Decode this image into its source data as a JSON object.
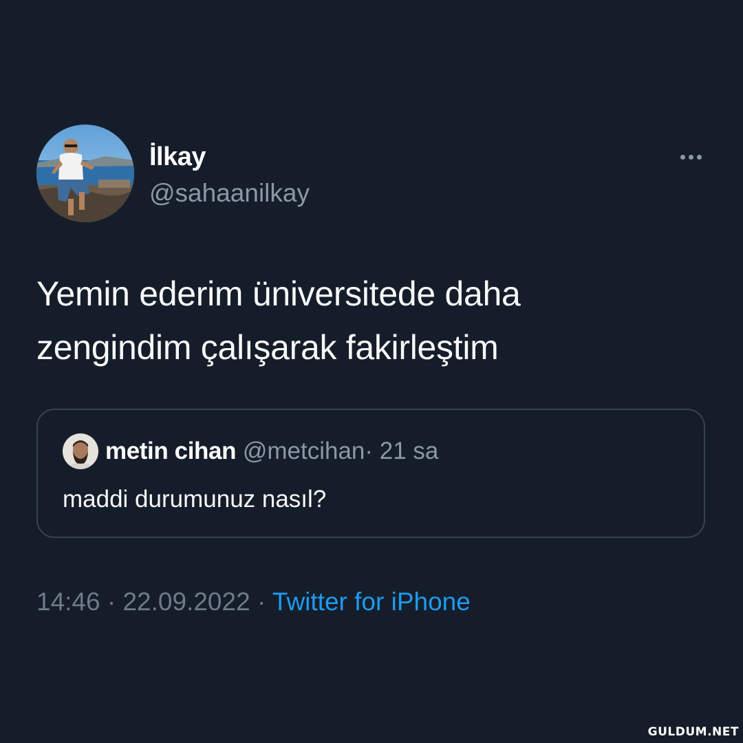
{
  "author": {
    "display_name": "İlkay",
    "handle": "@sahaanilkay",
    "avatar": "avatar-photo-man-sunglasses-seaside"
  },
  "more_icon": "more-horizontal-icon",
  "tweet": {
    "text_line1": "Yemin ederim üniversitede daha",
    "text_line2": "zengindim çalışarak fakirleştim"
  },
  "quoted_tweet": {
    "avatar": "avatar-photo-bearded-man",
    "display_name": "metin cihan",
    "handle": "@metcihan",
    "separator": "·",
    "time": "21 sa",
    "text": "maddi durumunuz nasıl?"
  },
  "meta": {
    "time": "14:46",
    "separator1": "·",
    "date": "22.09.2022",
    "separator2": "·",
    "source": "Twitter for iPhone"
  },
  "watermark": "GULDUM.NET",
  "colors": {
    "background": "#161d2a",
    "primary_text": "#f7f9f9",
    "secondary_text": "#8b98a5",
    "link": "#1d9bf0",
    "border": "#38444d"
  }
}
